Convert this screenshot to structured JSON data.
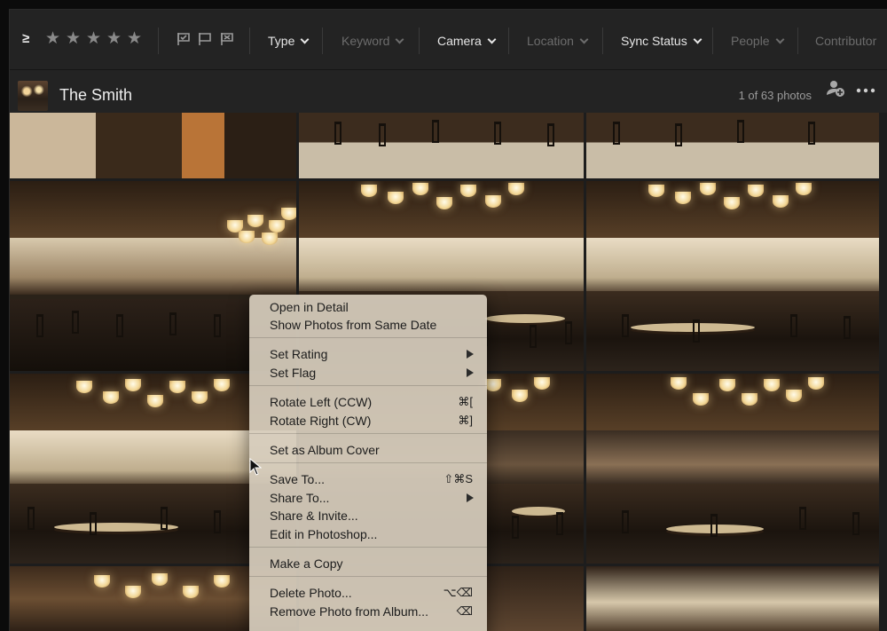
{
  "filter_bar": {
    "rating_operator": "≥",
    "star_count": 5,
    "filters": [
      {
        "label": "Type",
        "enabled": true
      },
      {
        "label": "Keyword",
        "enabled": false
      },
      {
        "label": "Camera",
        "enabled": true
      },
      {
        "label": "Location",
        "enabled": false
      },
      {
        "label": "Sync Status",
        "enabled": true
      },
      {
        "label": "People",
        "enabled": false
      },
      {
        "label": "Contributor",
        "enabled": false
      }
    ]
  },
  "album": {
    "title": "The Smith",
    "count": "1 of 63 photos"
  },
  "context_menu": {
    "items": [
      {
        "label": "Open in Detail",
        "shortcut": "",
        "submenu": false
      },
      {
        "label": "Show Photos from Same Date",
        "shortcut": "",
        "submenu": false
      },
      {
        "label": "Set Rating",
        "shortcut": "",
        "submenu": true
      },
      {
        "label": "Set Flag",
        "shortcut": "",
        "submenu": true
      },
      {
        "label": "Rotate Left (CCW)",
        "shortcut": "⌘[",
        "submenu": false
      },
      {
        "label": "Rotate Right (CW)",
        "shortcut": "⌘]",
        "submenu": false
      },
      {
        "label": "Set as Album Cover",
        "shortcut": "",
        "submenu": false
      },
      {
        "label": "Save To...",
        "shortcut": "⇧⌘S",
        "submenu": false
      },
      {
        "label": "Share To...",
        "shortcut": "",
        "submenu": true
      },
      {
        "label": "Share & Invite...",
        "shortcut": "",
        "submenu": false
      },
      {
        "label": "Edit in Photoshop...",
        "shortcut": "",
        "submenu": false
      },
      {
        "label": "Make a Copy",
        "shortcut": "",
        "submenu": false
      },
      {
        "label": "Delete Photo...",
        "shortcut": "⌥⌫",
        "submenu": false
      },
      {
        "label": "Remove Photo from Album...",
        "shortcut": "⌫",
        "submenu": false
      }
    ]
  },
  "colors": {
    "background": "#1d1d1d",
    "toolbar": "#232323",
    "menu": "#d6ccbc",
    "selection_outline": "#f2f2f2"
  }
}
